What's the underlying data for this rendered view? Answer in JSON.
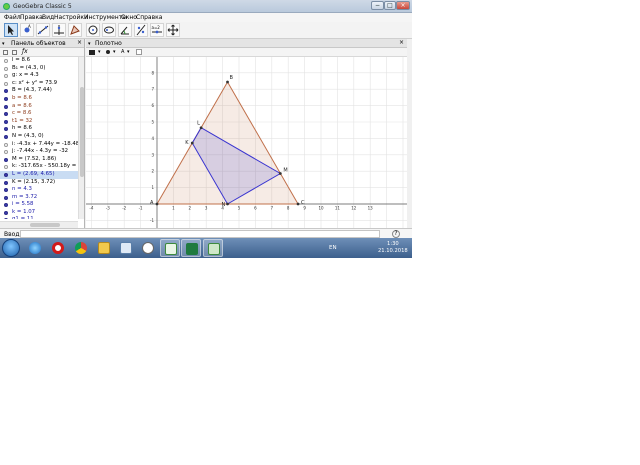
{
  "window": {
    "title": "GeoGebra Classic 5",
    "controls": {
      "minimize": "−",
      "maximize": "□",
      "close": "×"
    }
  },
  "menu": [
    "Файл",
    "Правка",
    "Вид",
    "Настройки",
    "Инструменты",
    "Окно",
    "Справка"
  ],
  "toolbar": {
    "tools": [
      "move-tool",
      "point-tool",
      "line-tool",
      "perpendicular-tool",
      "polygon-tool",
      "circle-tool",
      "ellipse-tool",
      "angle-tool",
      "reflect-tool",
      "slider-tool",
      "move-view-tool"
    ],
    "slider_label": "a=2"
  },
  "algebra_panel": {
    "title": "Панель объектов",
    "close": "×",
    "rows": [
      {
        "text": "l = 8.6",
        "color": "#000000",
        "dot": "#ffffff"
      },
      {
        "text": "B₁ = (4.3, 0)",
        "color": "#000000",
        "dot": "#ffffff"
      },
      {
        "text": "g: x = 4.3",
        "color": "#000000",
        "dot": "#ffffff"
      },
      {
        "text": "c: x² + y² = 73.9",
        "color": "#000000",
        "dot": "#ffffff"
      },
      {
        "text": "B = (4.3, 7.44)",
        "color": "#000000",
        "dot": "#3d3dad"
      },
      {
        "text": "b = 8.6",
        "color": "#8b3a1a",
        "dot": "#3d3dad"
      },
      {
        "text": "a = 8.6",
        "color": "#8b3a1a",
        "dot": "#3d3dad"
      },
      {
        "text": "c = 8.6",
        "color": "#8b3a1a",
        "dot": "#3d3dad"
      },
      {
        "text": "t1 = 32",
        "color": "#8b3a1a",
        "dot": "#3d3dad"
      },
      {
        "text": "h = 8.6",
        "color": "#000000",
        "dot": "#3d3dad"
      },
      {
        "text": "N = (4.3, 0)",
        "color": "#000000",
        "dot": "#3d3dad"
      },
      {
        "text": "i: -4.3x + 7.44y = -18.48",
        "color": "#000000",
        "dot": "#ffffff"
      },
      {
        "text": "j: -7.44x - 4.3y = -32",
        "color": "#000000",
        "dot": "#ffffff"
      },
      {
        "text": "M = (7.52, 1.86)",
        "color": "#000000",
        "dot": "#3d3dad"
      },
      {
        "text": "k: -317.65x - 550.18y = -",
        "color": "#000000",
        "dot": "#ffffff"
      },
      {
        "text": "L = (2.69, 4.65)",
        "color": "#1a1aa8",
        "dot": "#3d3dad",
        "selected": true
      },
      {
        "text": "K = (2.15, 3.72)",
        "color": "#000000",
        "dot": "#3d3dad"
      },
      {
        "text": "n = 4.3",
        "color": "#1a1aa8",
        "dot": "#3d3dad"
      },
      {
        "text": "m = 3.72",
        "color": "#1a1aa8",
        "dot": "#3d3dad"
      },
      {
        "text": "i = 5.58",
        "color": "#1a1aa8",
        "dot": "#3d3dad"
      },
      {
        "text": "k = 1.07",
        "color": "#1a1aa8",
        "dot": "#3d3dad"
      },
      {
        "text": "q1 = 11",
        "color": "#1a1aa8",
        "dot": "#3d3dad"
      }
    ]
  },
  "graphics": {
    "title": "Полотно",
    "close": "×",
    "x_ticks": [
      "-4",
      "-3",
      "-2",
      "-1",
      "1",
      "2",
      "3",
      "4",
      "5",
      "6",
      "7",
      "8",
      "9",
      "10",
      "11",
      "12",
      "13"
    ],
    "y_ticks": [
      "8",
      "7",
      "6",
      "5",
      "4",
      "3",
      "2",
      "1",
      "-1"
    ],
    "points": {
      "A": [
        0,
        0
      ],
      "B": [
        4.3,
        7.44
      ],
      "C": [
        8.6,
        0
      ],
      "N": [
        4.3,
        0
      ],
      "M": [
        7.52,
        1.86
      ],
      "L": [
        2.69,
        4.65
      ],
      "K": [
        2.15,
        3.72
      ]
    },
    "triangle_color": "#c0704a",
    "quad_color": "#3a35d0"
  },
  "input": {
    "label": "Ввод:",
    "value": "",
    "help": "?"
  },
  "taskbar": {
    "apps": [
      "ie-icon",
      "opera-icon",
      "chrome-icon",
      "explorer-icon",
      "picture-icon",
      "player-icon",
      "geogebra-icon",
      "excel-icon",
      "geogebra-window-icon"
    ],
    "lang": "EN",
    "time": "1:30",
    "date": "21.10.2018"
  }
}
